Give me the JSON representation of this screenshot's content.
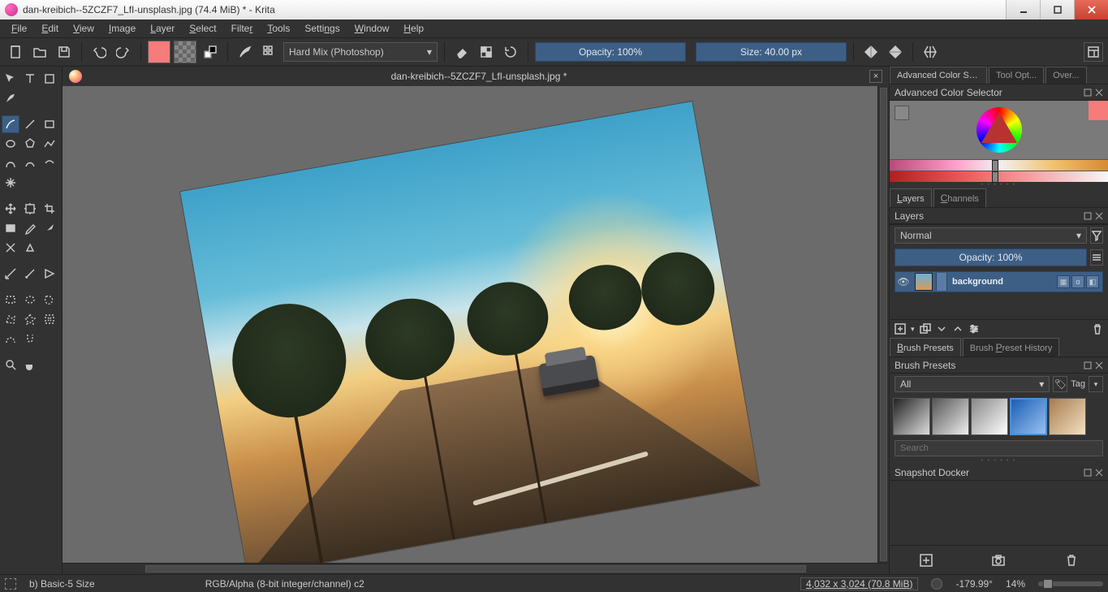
{
  "titlebar": {
    "text": "dan-kreibich--5ZCZF7_LfI-unsplash.jpg (74.4 MiB) * - Krita"
  },
  "menu": {
    "file": "File",
    "edit": "Edit",
    "view": "View",
    "image": "Image",
    "layer": "Layer",
    "select": "Select",
    "filter": "Filter",
    "tools": "Tools",
    "settings": "Settings",
    "window": "Window",
    "help": "Help"
  },
  "toolbar": {
    "blend_mode": "Hard Mix (Photoshop)",
    "opacity": "Opacity: 100%",
    "size": "Size: 40.00 px"
  },
  "tab": {
    "title": "dan-kreibich--5ZCZF7_LfI-unsplash.jpg *"
  },
  "dockers": {
    "top_tab1": "Advanced Color Sele...",
    "top_tab2": "Tool Opt...",
    "top_tab3": "Over...",
    "acs_title": "Advanced Color Selector",
    "layers_tab": "Layers",
    "channels_tab": "Channels",
    "layers_title": "Layers",
    "blend": "Normal",
    "opacity": "Opacity:  100%",
    "layer1": "background",
    "presets_tab": "Brush Presets",
    "history_tab": "Brush Preset History",
    "presets_title": "Brush Presets",
    "preset_filter": "All",
    "tag": "Tag",
    "search_placeholder": "Search",
    "snapshot_title": "Snapshot Docker"
  },
  "status": {
    "brush": "b) Basic-5 Size",
    "colormodel": "RGB/Alpha (8-bit integer/channel)  c2",
    "dims": "4,032 x 3,024 (70.8 MiB)",
    "angle": "-179.99°",
    "zoom": "14%"
  }
}
